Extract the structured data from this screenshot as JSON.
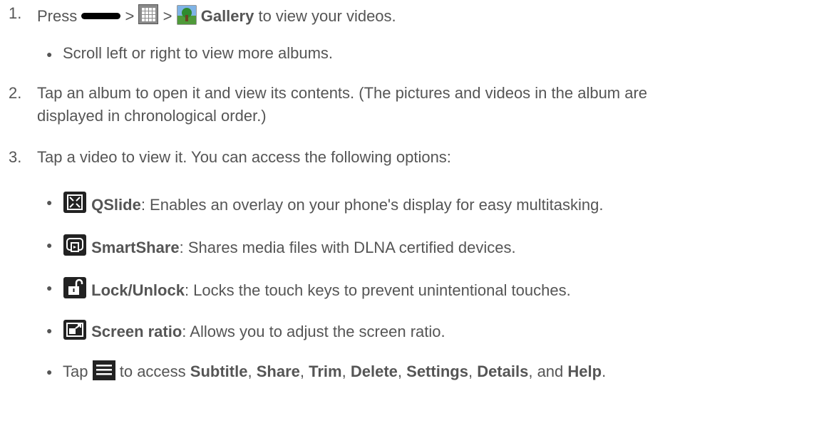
{
  "steps": [
    {
      "number": "1.",
      "text_press": "Press",
      "sep1": ">",
      "sep2": ">",
      "bold_gallery": "Gallery",
      "text_after": "to view your videos.",
      "icons": [
        "home-key-icon",
        "apps-grid-icon",
        "gallery-icon"
      ],
      "sub_bullets": [
        {
          "text": "Scroll left or right to view more albums."
        }
      ]
    },
    {
      "number": "2.",
      "line1": "Tap an album to open it and view its contents. (The pictures and videos in the album are",
      "line2": "displayed in chronological order.)"
    },
    {
      "number": "3.",
      "text": "Tap a video to view it. You can access the following options:",
      "options": [
        {
          "icon": "qslide-icon",
          "label": "QSlide",
          "desc": ": Enables an overlay on your phone's display for easy multitasking."
        },
        {
          "icon": "smartshare-icon",
          "label": "SmartShare",
          "desc": ": Shares media files with DLNA certified devices."
        },
        {
          "icon": "lock-icon",
          "label": "Lock/Unlock",
          "desc": ": Locks the touch keys to prevent unintentional touches."
        },
        {
          "icon": "screen-ratio-icon",
          "label": "Screen ratio",
          "desc": ": Allows you to adjust the screen ratio."
        }
      ],
      "menu_line": {
        "tap": "Tap",
        "icon": "menu-icon",
        "to_access": "to access",
        "items": [
          "Subtitle",
          "Share",
          "Trim",
          "Delete",
          "Settings",
          "Details",
          "Help"
        ],
        "comma": ",",
        "and": ", and",
        "period": "."
      }
    }
  ]
}
